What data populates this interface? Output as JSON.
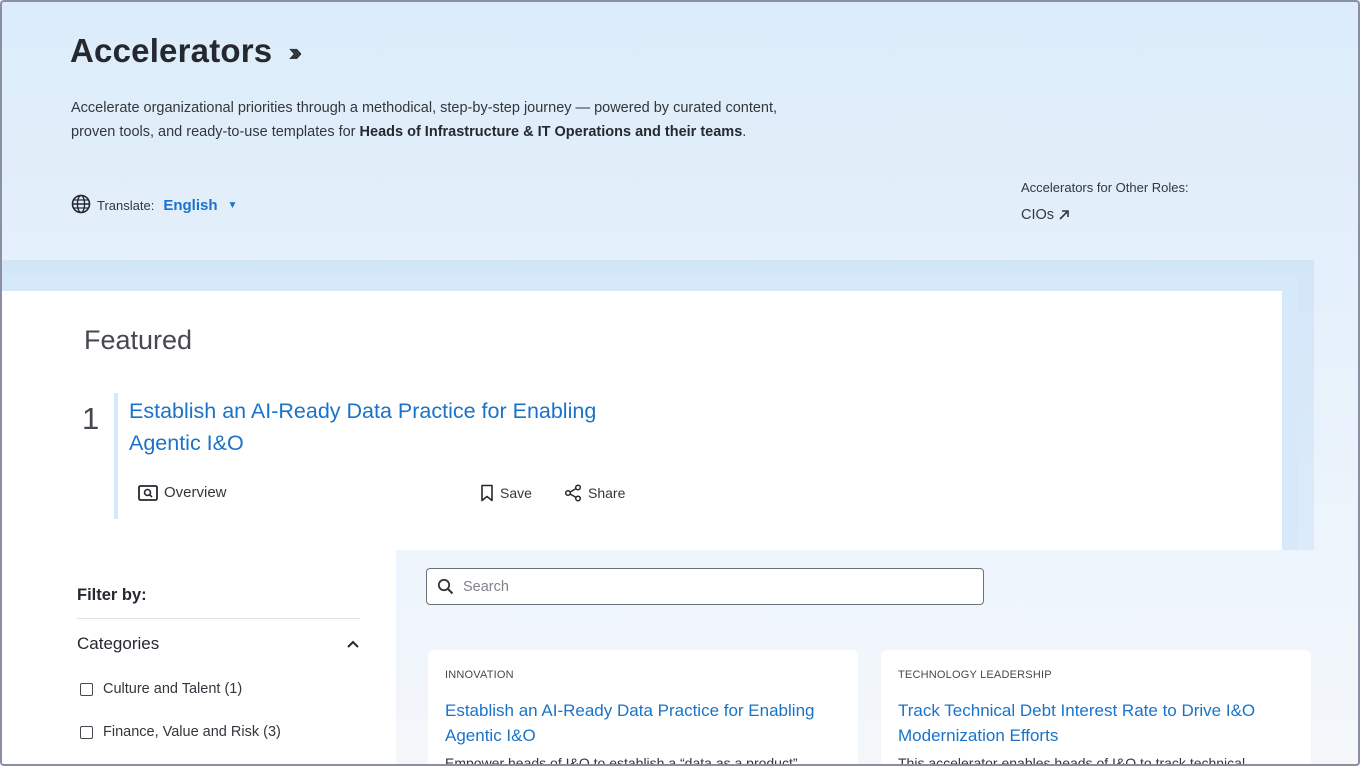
{
  "hero": {
    "title": "Accelerators",
    "description_prefix": "Accelerate organizational priorities through a methodical, step-by-step journey — powered by curated content, proven tools, and ready-to-use templates for ",
    "description_bold": "Heads of Infrastructure & IT Operations and their teams",
    "description_suffix": ".",
    "translate_label": "Translate:",
    "translate_value": "English",
    "other_roles_label": "Accelerators for Other Roles:",
    "other_roles_link": "CIOs"
  },
  "featured": {
    "heading": "Featured",
    "number": "1",
    "title": "Establish an AI-Ready Data Practice for Enabling Agentic I&O",
    "overview_label": "Overview",
    "save_label": "Save",
    "share_label": "Share"
  },
  "filters": {
    "title": "Filter by:",
    "categories_label": "Categories",
    "options": [
      {
        "label": "Culture and Talent (1)",
        "checked": false
      },
      {
        "label": "Finance, Value and Risk (3)",
        "checked": false
      }
    ]
  },
  "search": {
    "placeholder": "Search",
    "value": ""
  },
  "cards": [
    {
      "tag": "INNOVATION",
      "title": "Establish an AI-Ready Data Practice for Enabling Agentic I&O",
      "description": "Empower heads of I&O to establish a “data as a product”"
    },
    {
      "tag": "TECHNOLOGY LEADERSHIP",
      "title": "Track Technical Debt Interest Rate to Drive I&O Modernization Efforts",
      "description": "This accelerator enables heads of I&O to track technical"
    }
  ],
  "colors": {
    "link": "#1a73c9",
    "text": "#25282e",
    "hero_bg": "#dcecfa"
  }
}
